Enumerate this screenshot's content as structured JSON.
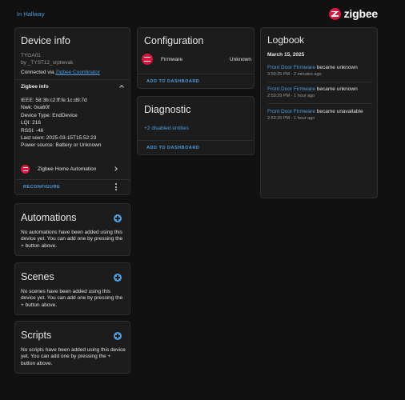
{
  "breadcrumb": "In Hallway",
  "brand": {
    "name": "zigbee",
    "color": "#d5163e",
    "icon": "zigbee-logo-icon"
  },
  "accent_color": "#4d9de0",
  "device_info": {
    "title": "Device info",
    "model": "TYGA01",
    "manufacturer": "by _TYST12_srptwvak",
    "connected_prefix": "Connected via ",
    "connected_link": "Zigbee Coordinator",
    "zigbee_info_title": "Zigbee info",
    "zigbee_info_lines": [
      "IEEE: 58:3b:c2:ff:fe:1c:d9:7d",
      "Nwk: 0xa60f",
      "Device Type: EndDevice",
      "LQI: 216",
      "RSSI: -46",
      "Last seen: 2025-03-15T15:52:23",
      "Power source: Battery or Unknown"
    ],
    "integration_label": "Zigbee Home Automation",
    "reconfigure_label": "RECONFIGURE"
  },
  "automations": {
    "title": "Automations",
    "body": "No automations have been added using this device yet. You can add one by pressing the + button above."
  },
  "scenes": {
    "title": "Scenes",
    "body": "No scenes have been added using this device yet. You can add one by pressing the + button above."
  },
  "scripts": {
    "title": "Scripts",
    "body": "No scripts have been added using this device yet. You can add one by pressing the + button above."
  },
  "configuration": {
    "title": "Configuration",
    "firmware_label": "Firmware",
    "firmware_value": "Unknown",
    "add_to_dashboard": "ADD TO DASHBOARD"
  },
  "diagnostic": {
    "title": "Diagnostic",
    "disabled_entities": "+2 disabled entities",
    "add_to_dashboard": "ADD TO DASHBOARD"
  },
  "logbook": {
    "title": "Logbook",
    "date": "March 15, 2025",
    "entries": [
      {
        "entity": "Front Door Firmware",
        "message": " became unknown",
        "time": "3:50:25 PM - 2 minutes ago"
      },
      {
        "entity": "Front Door Firmware",
        "message": " became unknown",
        "time": "2:53:29 PM - 1 hour ago"
      },
      {
        "entity": "Front Door Firmware",
        "message": " became unavailable",
        "time": "2:53:26 PM - 1 hour ago"
      }
    ]
  }
}
